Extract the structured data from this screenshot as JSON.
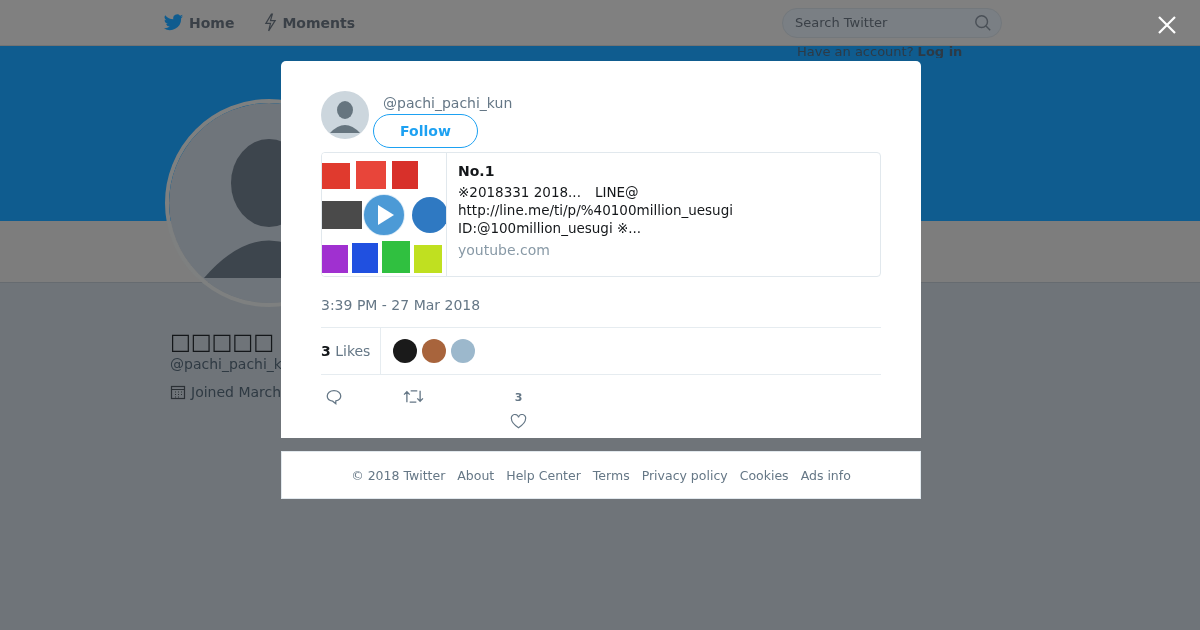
{
  "top_nav": {
    "items": [
      {
        "label": "Home",
        "kind": "bird"
      },
      {
        "label": "Moments",
        "kind": "bolt"
      }
    ],
    "search": {
      "placeholder": "Search Twitter"
    },
    "login_prompt": {
      "text": "Have an account?",
      "link": "Log in"
    }
  },
  "profile": {
    "name": "□□□□□",
    "handle": "@pachi_pachi_k",
    "joined": "Joined March"
  },
  "tweet": {
    "handle": "@pachi_pachi_kun",
    "follow_button": "Follow",
    "card": {
      "media": {
        "kind": "picture",
        "play_button": true
      },
      "title": "No.1",
      "description": [
        "※2018331 2018...　LINE@",
        "http://line.me/ti/p/%40100million_uesugi",
        "ID:@100million_uesugi ※..."
      ],
      "domain": "youtube.com"
    },
    "timestamp": "3:39 PM - 27 Mar 2018",
    "likes": {
      "count": "3",
      "label": "Likes",
      "likers": [
        {
          "color": "#1a1a1a"
        },
        {
          "color": "#a8643c"
        },
        {
          "color": "#9cb8cc"
        }
      ]
    },
    "actions": {
      "like_count": "3"
    }
  },
  "footer": [
    "© 2018 Twitter",
    "About",
    "Help Center",
    "Terms",
    "Privacy policy",
    "Cookies",
    "Ads info"
  ]
}
